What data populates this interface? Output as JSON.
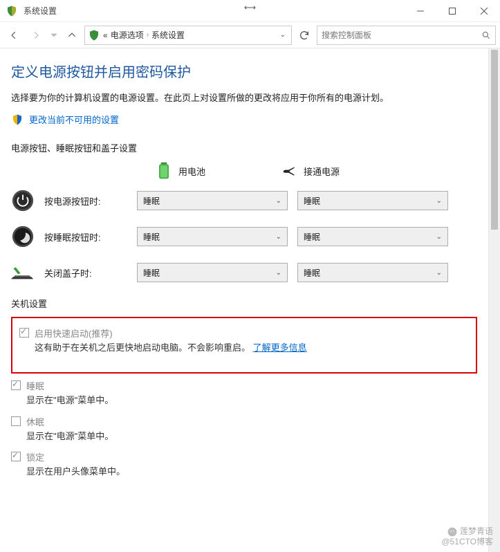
{
  "window": {
    "title": "系统设置"
  },
  "breadcrumb": {
    "prefix_glyph": "«",
    "item1": "电源选项",
    "item2": "系统设置"
  },
  "search": {
    "placeholder": "搜索控制面板"
  },
  "page": {
    "title": "定义电源按钮并启用密码保护",
    "intro": "选择要为你的计算机设置的电源设置。在此页上对设置所做的更改将应用于你所有的电源计划。",
    "unlock_link": "更改当前不可用的设置"
  },
  "section1": {
    "title": "电源按钮、睡眠按钮和盖子设置",
    "col_battery": "用电池",
    "col_plugged": "接通电源",
    "rows": [
      {
        "label": "按电源按钮时:",
        "battery": "睡眠",
        "plugged": "睡眠"
      },
      {
        "label": "按睡眠按钮时:",
        "battery": "睡眠",
        "plugged": "睡眠"
      },
      {
        "label": "关闭盖子时:",
        "battery": "睡眠",
        "plugged": "睡眠"
      }
    ]
  },
  "section2": {
    "title": "关机设置",
    "fastboot": {
      "label": "启用快速启动(推荐)",
      "desc_prefix": "这有助于在关机之后更快地启动电脑。不会影响重启。",
      "desc_link": "了解更多信息"
    },
    "sleep": {
      "label": "睡眠",
      "desc": "显示在\"电源\"菜单中。"
    },
    "hibernate": {
      "label": "休眠",
      "desc": "显示在\"电源\"菜单中。"
    },
    "lock": {
      "label": "锁定",
      "desc": "显示在用户头像菜单中。"
    }
  },
  "watermark": {
    "line1": "莲梦青语",
    "line2": "@51CTO博客"
  }
}
